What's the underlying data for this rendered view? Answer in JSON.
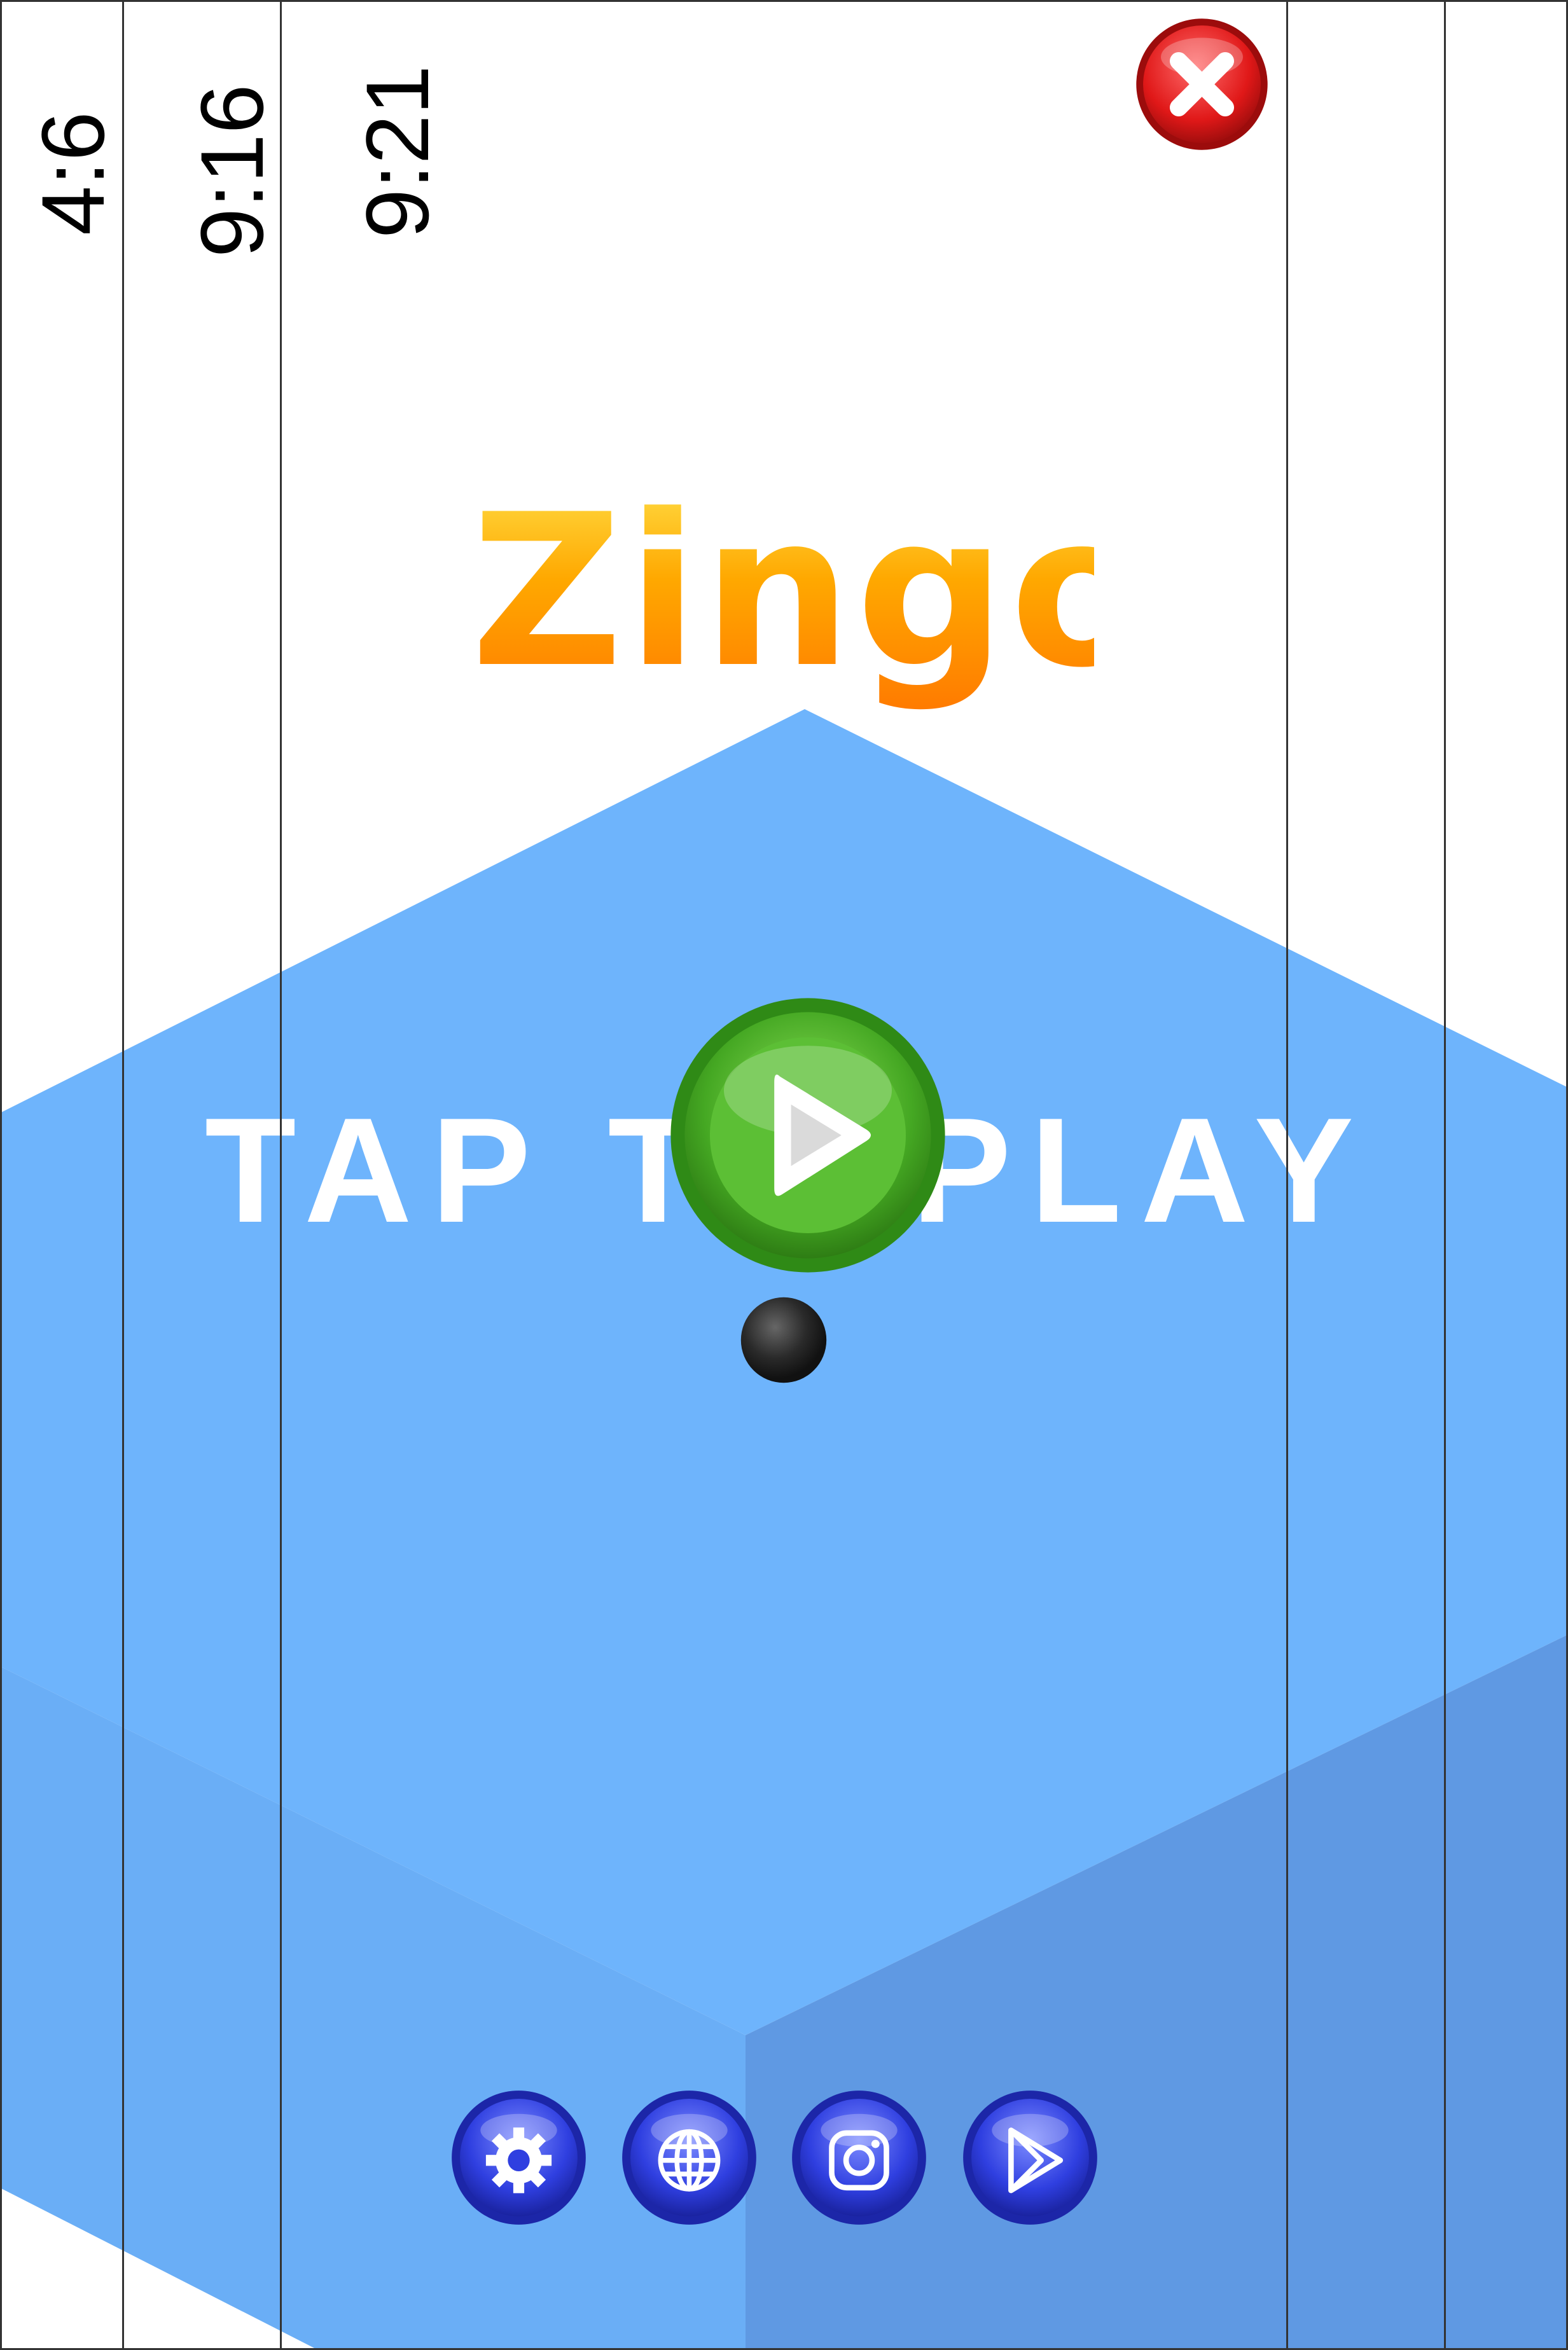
{
  "aspect_ratio_labels": [
    "4:6",
    "9:16",
    "9:21"
  ],
  "game": {
    "title": "Zingo",
    "prompt": "TAP TO PLAY"
  },
  "buttons": {
    "close": "close-icon",
    "play": "play-icon",
    "settings": "gear-icon",
    "website": "globe-icon",
    "instagram": "instagram-icon",
    "store": "play-store-icon"
  },
  "colors": {
    "background": "#ffffff",
    "platform_top": "#6eb4fc",
    "platform_side": "#5f99e3",
    "play_button": "#4caf2a",
    "close_button": "#e02020",
    "dock_button": "#2f3fe0",
    "ball": "#222222",
    "title_top": "#ffe14a",
    "title_bottom": "#ff7a00"
  }
}
